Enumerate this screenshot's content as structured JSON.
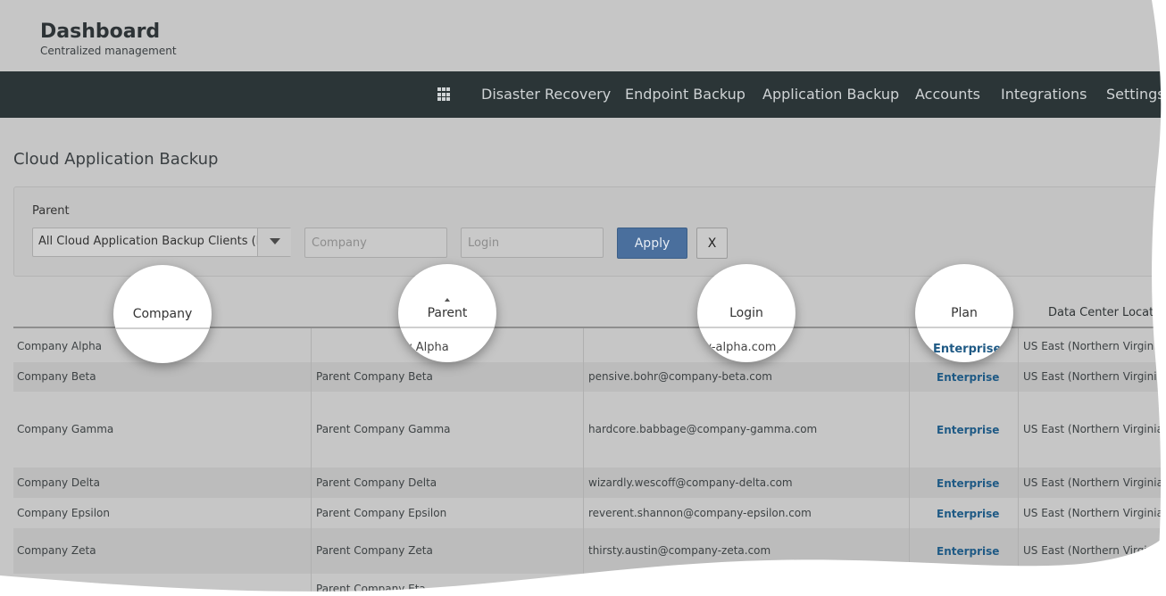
{
  "header": {
    "title": "Dashboard",
    "subtitle": "Centralized management"
  },
  "nav": {
    "items": [
      {
        "label": "Disaster Recovery"
      },
      {
        "label": "Endpoint Backup"
      },
      {
        "label": "Application Backup"
      },
      {
        "label": "Accounts"
      },
      {
        "label": "Integrations"
      },
      {
        "label": "Settings"
      }
    ]
  },
  "page": {
    "title": "Cloud Application Backup"
  },
  "filters": {
    "parent_label": "Parent",
    "parent_value": "All Cloud Application Backup Clients (In a",
    "company_placeholder": "Company",
    "login_placeholder": "Login",
    "apply_label": "Apply",
    "clear_label": "X"
  },
  "table": {
    "columns": [
      "Company",
      "Parent",
      "Login",
      "Plan",
      "Data Center Location"
    ],
    "rows": [
      {
        "company": "Company Alpha",
        "parent": "Parent Company Alpha",
        "login": "stoic.allen@company-alpha.com",
        "plan": "Enterprise",
        "location": "US East (Northern Virginia)"
      },
      {
        "company": "Company Beta",
        "parent": "Parent Company Beta",
        "login": "pensive.bohr@company-beta.com",
        "plan": "Enterprise",
        "location": "US East (Northern Virginia)"
      },
      {
        "company": "Company Gamma",
        "parent": "Parent Company Gamma",
        "login": "hardcore.babbage@company-gamma.com",
        "plan": "Enterprise",
        "location": "US East (Northern Virginia)"
      },
      {
        "company": "Company Delta",
        "parent": "Parent Company Delta",
        "login": "wizardly.wescoff@company-delta.com",
        "plan": "Enterprise",
        "location": "US East (Northern Virginia)"
      },
      {
        "company": "Company Epsilon",
        "parent": "Parent Company Epsilon",
        "login": "reverent.shannon@company-epsilon.com",
        "plan": "Enterprise",
        "location": "US East (Northern Virginia)"
      },
      {
        "company": "Company Zeta",
        "parent": "Parent Company Zeta",
        "login": "thirsty.austin@company-zeta.com",
        "plan": "Enterprise",
        "location": "US East (Northern Virginia)"
      },
      {
        "company": "",
        "parent": "Parent Company Eta",
        "login": "",
        "plan": "",
        "location": ""
      }
    ]
  },
  "magnifiers": {
    "company": "Company",
    "parent": "Parent",
    "login": "Login",
    "plan": "Plan",
    "parent_row": "Parent Company Alpha",
    "login_row": "stoic.allen@company-alpha.com",
    "plan_row": "Enterprise"
  },
  "colors": {
    "navbar": "#2b3537",
    "apply": "#4a6f9d",
    "plan_text": "#1f5a85"
  }
}
